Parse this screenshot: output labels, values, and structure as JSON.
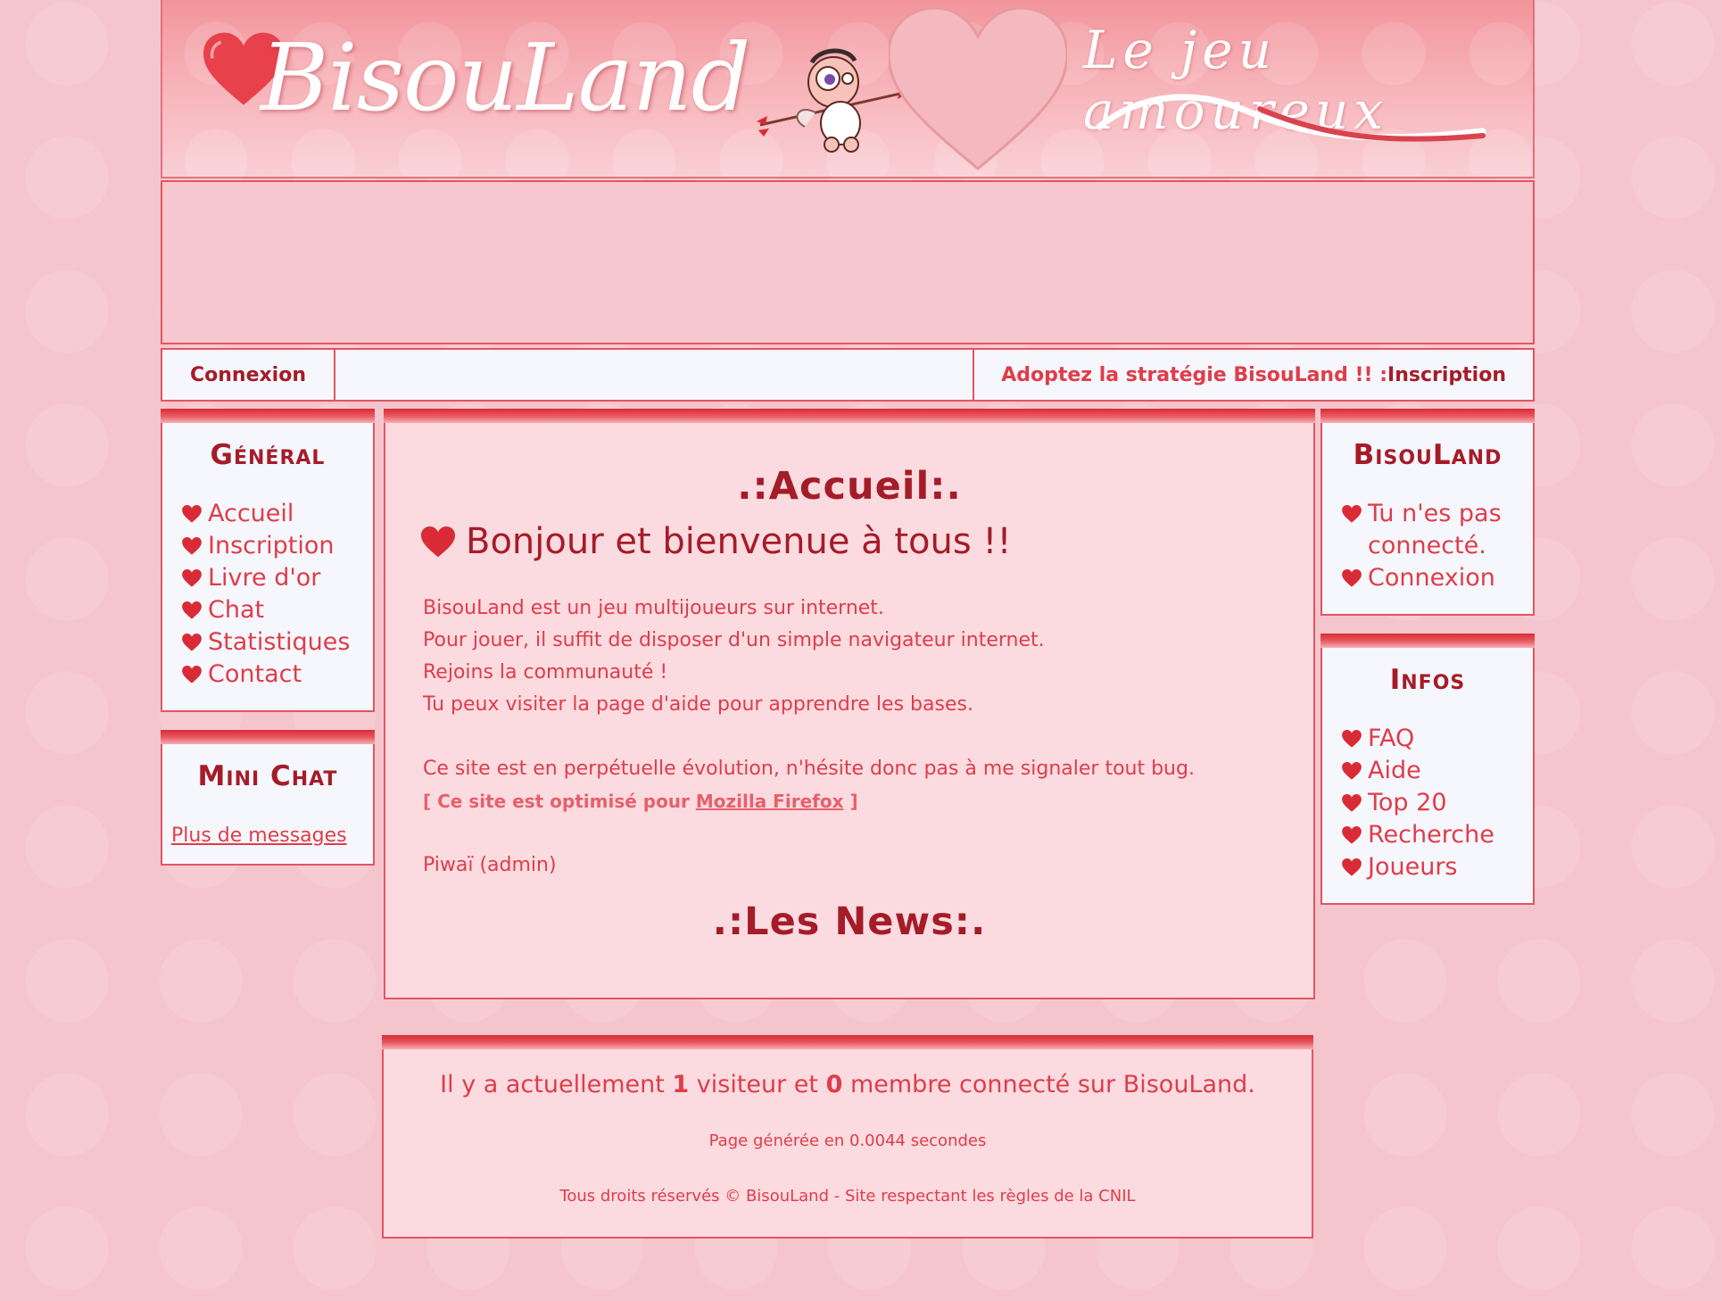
{
  "header": {
    "logo": "BisouLand",
    "tagline": "Le jeu amoureux"
  },
  "topnav": {
    "login": "Connexion",
    "promo": "Adoptez la stratégie BisouLand !! : ",
    "signup": "Inscription"
  },
  "left": {
    "general": {
      "title": "Général",
      "items": [
        "Accueil",
        "Inscription",
        "Livre d'or",
        "Chat",
        "Statistiques",
        "Contact"
      ]
    },
    "minichat": {
      "title": "Mini Chat",
      "more": "Plus de messages"
    }
  },
  "right": {
    "bisouland": {
      "title": "BisouLand",
      "status_line1": "Tu n'es pas",
      "status_line2": "connecté.",
      "login": "Connexion"
    },
    "infos": {
      "title": "Infos",
      "items": [
        "FAQ",
        "Aide",
        "Top 20",
        "Recherche",
        "Joueurs"
      ]
    }
  },
  "main": {
    "title": ".:Accueil:.",
    "welcome": "Bonjour et bienvenue à tous !!",
    "lines": [
      "BisouLand est un jeu multijoueurs sur internet.",
      "Pour jouer, il suffit de disposer d'un simple navigateur internet.",
      "Rejoins la communauté !",
      "Tu peux visiter la page d'aide pour apprendre les bases."
    ],
    "evolution": "Ce site est en perpétuelle évolution, n'hésite donc pas à me signaler tout bug.",
    "optimized_prefix": "[ Ce site est optimisé pour ",
    "optimized_link": "Mozilla Firefox",
    "optimized_suffix": " ]",
    "signature": "Piwaï (admin)",
    "news_title": ".:Les News:."
  },
  "footer": {
    "online_a": "Il y a actuellement ",
    "visitors": "1",
    "online_b": " visiteur et ",
    "members": "0",
    "online_c": " membre connecté sur BisouLand.",
    "generated": "Page générée en 0.0044 secondes",
    "rights": "Tous droits réservés © BisouLand - Site respectant les règles de la CNIL"
  },
  "colors": {
    "accent": "#e03c4a",
    "dark": "#a51c29",
    "background": "#f5c5cd"
  }
}
